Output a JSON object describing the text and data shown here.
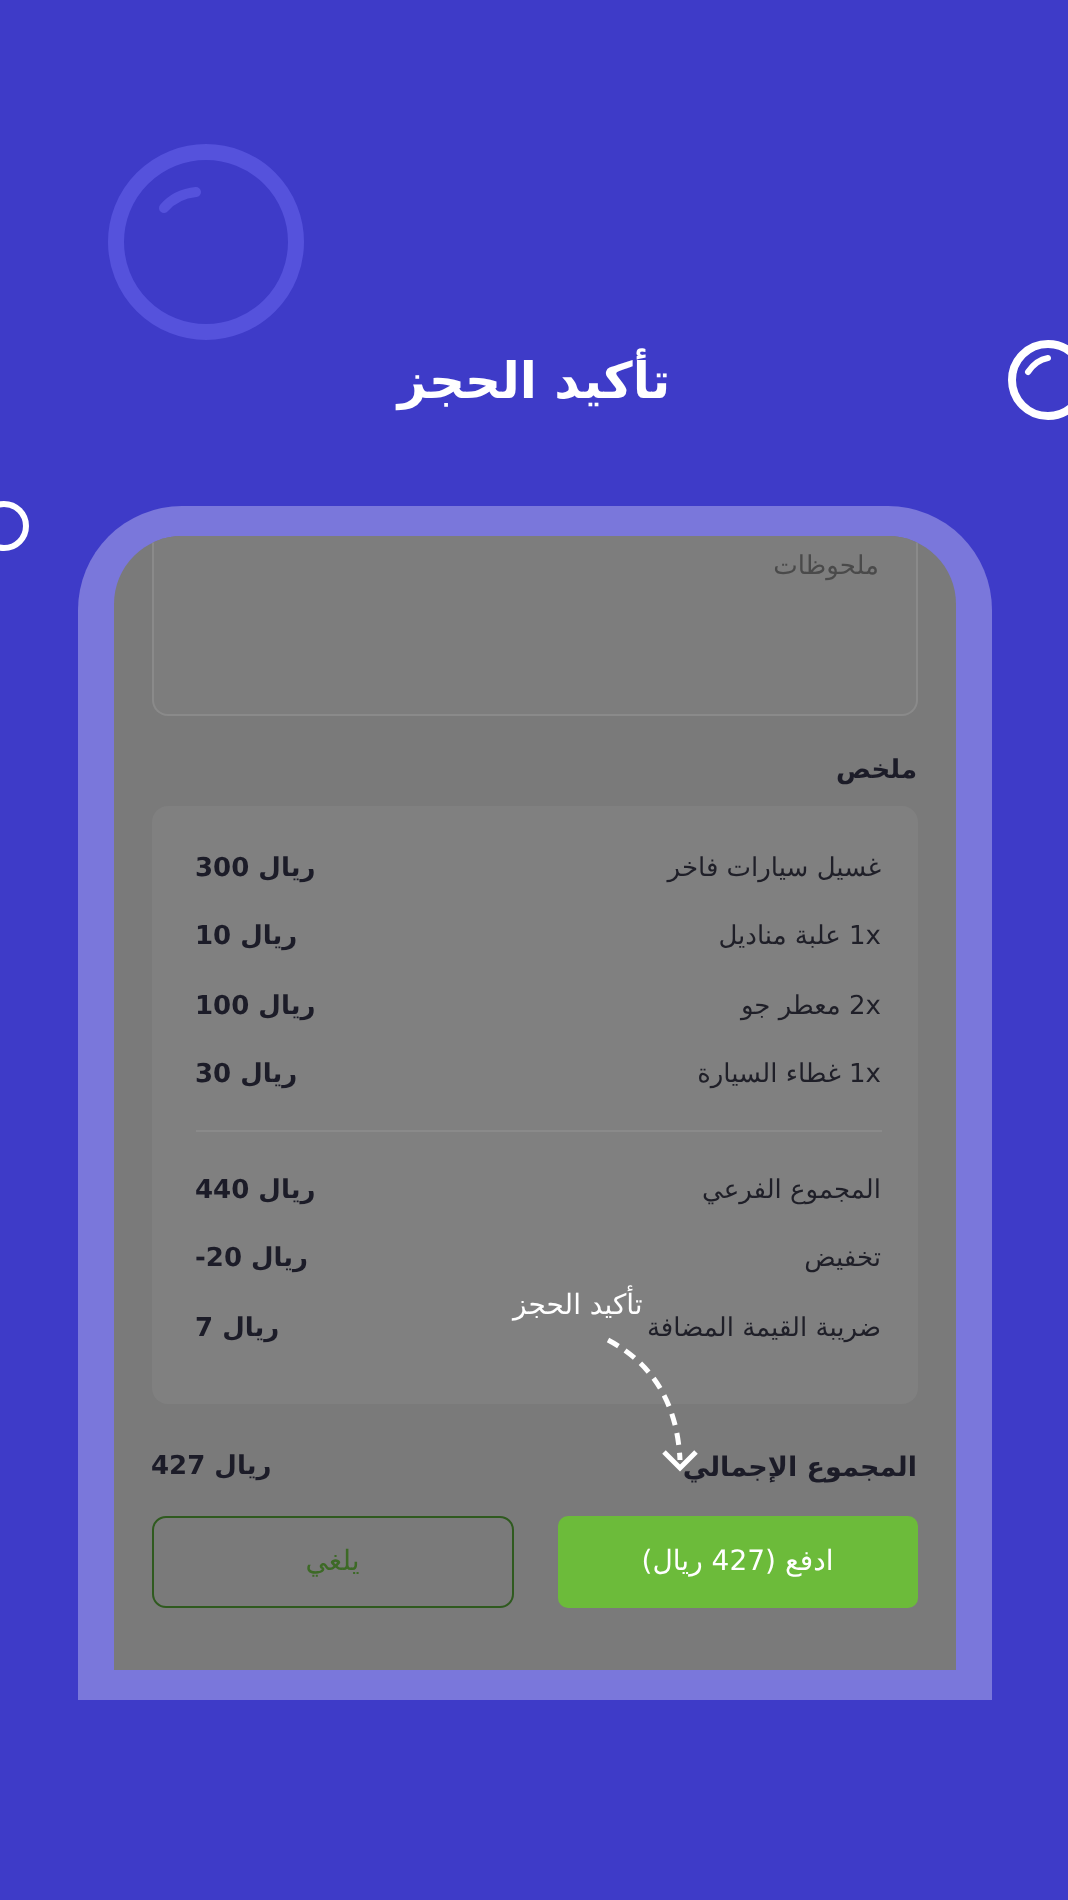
{
  "title": "تأكيد الحجز",
  "notes": {
    "placeholder": "ملحوظات"
  },
  "summary_heading": "ملخص",
  "items": [
    {
      "label": "غسيل سيارات فاخر",
      "amount": "300 ريال"
    },
    {
      "label": "1x علبة مناديل",
      "amount": "10 ريال"
    },
    {
      "label": "2x معطر جو",
      "amount": "100 ريال"
    },
    {
      "label": "1x غطاء السيارة",
      "amount": "30 ريال"
    }
  ],
  "totals": [
    {
      "label": "المجموع الفرعي",
      "amount": "440 ريال"
    },
    {
      "label": "تخفيض",
      "amount": "-20 ريال"
    },
    {
      "label": "ضريبة القيمة المضافة",
      "amount": "7 ريال"
    }
  ],
  "grand_total": {
    "label": "المجموع الإجمالي",
    "amount": "427 ريال"
  },
  "hint": "تأكيد الحجز",
  "buttons": {
    "pay": "ادفع (427 ريال)",
    "cancel": "يلغي"
  }
}
